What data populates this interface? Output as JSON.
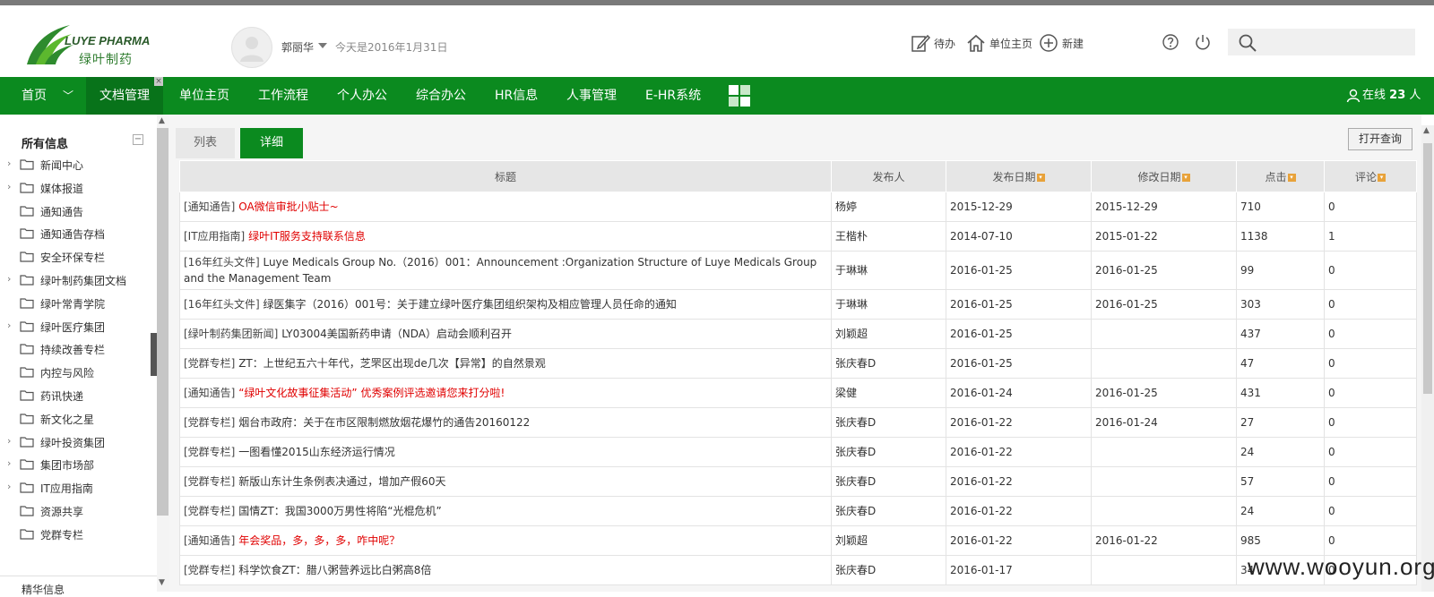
{
  "brand": {
    "logo_en": "LUYE PHARMA",
    "logo_cn": "绿叶制药",
    "green": "#0b8a1f",
    "red": "#e00000"
  },
  "user": {
    "name": "郭丽华",
    "today": "今天是2016年1月31日"
  },
  "toolbar": {
    "todo": "待办",
    "unit_home": "单位主页",
    "new": "新建"
  },
  "search": {
    "placeholder": ""
  },
  "nav": {
    "items": [
      "首页",
      "文档管理",
      "单位主页",
      "工作流程",
      "个人办公",
      "综合办公",
      "HR信息",
      "人事管理",
      "E-HR系统"
    ],
    "active": "文档管理",
    "close": "×",
    "online": "在线",
    "online_count": "23",
    "online_unit": "人"
  },
  "sidebar": {
    "title": "所有信息",
    "collapse": "−",
    "items": [
      {
        "label": "新闻中心",
        "expandable": true
      },
      {
        "label": "媒体报道",
        "expandable": true
      },
      {
        "label": "通知通告",
        "expandable": false
      },
      {
        "label": "通知通告存档",
        "expandable": false
      },
      {
        "label": "安全环保专栏",
        "expandable": false
      },
      {
        "label": "绿叶制药集团文档",
        "expandable": true
      },
      {
        "label": "绿叶常青学院",
        "expandable": false
      },
      {
        "label": "绿叶医疗集团",
        "expandable": true
      },
      {
        "label": "持续改善专栏",
        "expandable": false
      },
      {
        "label": "内控与风险",
        "expandable": false
      },
      {
        "label": "药讯快递",
        "expandable": false
      },
      {
        "label": "新文化之星",
        "expandable": false
      },
      {
        "label": "绿叶投资集团",
        "expandable": true
      },
      {
        "label": "集团市场部",
        "expandable": true
      },
      {
        "label": "IT应用指南",
        "expandable": true
      },
      {
        "label": "资源共享",
        "expandable": false
      },
      {
        "label": "党群专栏",
        "expandable": false
      }
    ],
    "footer": "精华信息"
  },
  "tabs": {
    "list": "列表",
    "detail": "详细",
    "active": "详细"
  },
  "query_button": "打开查询",
  "table": {
    "headers": [
      "标题",
      "发布人",
      "发布日期",
      "修改日期",
      "点击",
      "评论"
    ],
    "rows": [
      {
        "category": "[通知通告]",
        "title": "OA微信审批小贴士~",
        "red": true,
        "author": "杨婷",
        "publish": "2015-12-29",
        "modify": "2015-12-29",
        "clicks": "710",
        "comments": "0"
      },
      {
        "category": "[IT应用指南]",
        "title": "绿叶IT服务支持联系信息",
        "red": true,
        "author": "王楷朴",
        "publish": "2014-07-10",
        "modify": "2015-01-22",
        "clicks": "1138",
        "comments": "1"
      },
      {
        "category": "[16年红头文件]",
        "title": "Luye Medicals Group No.（2016）001：Announcement :Organization Structure of Luye Medicals Group and the Management Team",
        "red": false,
        "author": "于琳琳",
        "publish": "2016-01-25",
        "modify": "2016-01-25",
        "clicks": "99",
        "comments": "0"
      },
      {
        "category": "[16年红头文件]",
        "title": "绿医集字（2016）001号：关于建立绿叶医疗集团组织架构及相应管理人员任命的通知",
        "red": false,
        "author": "于琳琳",
        "publish": "2016-01-25",
        "modify": "2016-01-25",
        "clicks": "303",
        "comments": "0"
      },
      {
        "category": "[绿叶制药集团新闻]",
        "title": "LY03004美国新药申请（NDA）启动会顺利召开",
        "red": false,
        "author": "刘颖超",
        "publish": "2016-01-25",
        "modify": "",
        "clicks": "437",
        "comments": "0"
      },
      {
        "category": "[党群专栏]",
        "title": "ZT：上世纪五六十年代，芝罘区出现de几次【异常】的自然景观",
        "red": false,
        "author": "张庆春D",
        "publish": "2016-01-25",
        "modify": "",
        "clicks": "47",
        "comments": "0"
      },
      {
        "category": "[通知通告]",
        "title": "“绿叶文化故事征集活动” 优秀案例评选邀请您来打分啦!",
        "red": true,
        "author": "梁健",
        "publish": "2016-01-24",
        "modify": "2016-01-25",
        "clicks": "431",
        "comments": "0"
      },
      {
        "category": "[党群专栏]",
        "title": "烟台市政府：关于在市区限制燃放烟花爆竹的通告20160122",
        "red": false,
        "author": "张庆春D",
        "publish": "2016-01-22",
        "modify": "2016-01-24",
        "clicks": "27",
        "comments": "0"
      },
      {
        "category": "[党群专栏]",
        "title": "一图看懂2015山东经济运行情况",
        "red": false,
        "author": "张庆春D",
        "publish": "2016-01-22",
        "modify": "",
        "clicks": "24",
        "comments": "0"
      },
      {
        "category": "[党群专栏]",
        "title": "新版山东计生条例表决通过，增加产假60天",
        "red": false,
        "author": "张庆春D",
        "publish": "2016-01-22",
        "modify": "",
        "clicks": "57",
        "comments": "0"
      },
      {
        "category": "[党群专栏]",
        "title": "国情ZT：我国3000万男性将陷“光棍危机”",
        "red": false,
        "author": "张庆春D",
        "publish": "2016-01-22",
        "modify": "",
        "clicks": "24",
        "comments": "0"
      },
      {
        "category": "[通知通告]",
        "title": "年会奖品，多，多，多，咋中呢？",
        "red": true,
        "author": "刘颖超",
        "publish": "2016-01-22",
        "modify": "2016-01-22",
        "clicks": "985",
        "comments": "0"
      },
      {
        "category": "[党群专栏]",
        "title": "科学饮食ZT：腊八粥营养远比白粥高8倍",
        "red": false,
        "author": "张庆春D",
        "publish": "2016-01-17",
        "modify": "",
        "clicks": "34",
        "comments": "0"
      }
    ]
  },
  "watermark": "www.wooyun.org"
}
